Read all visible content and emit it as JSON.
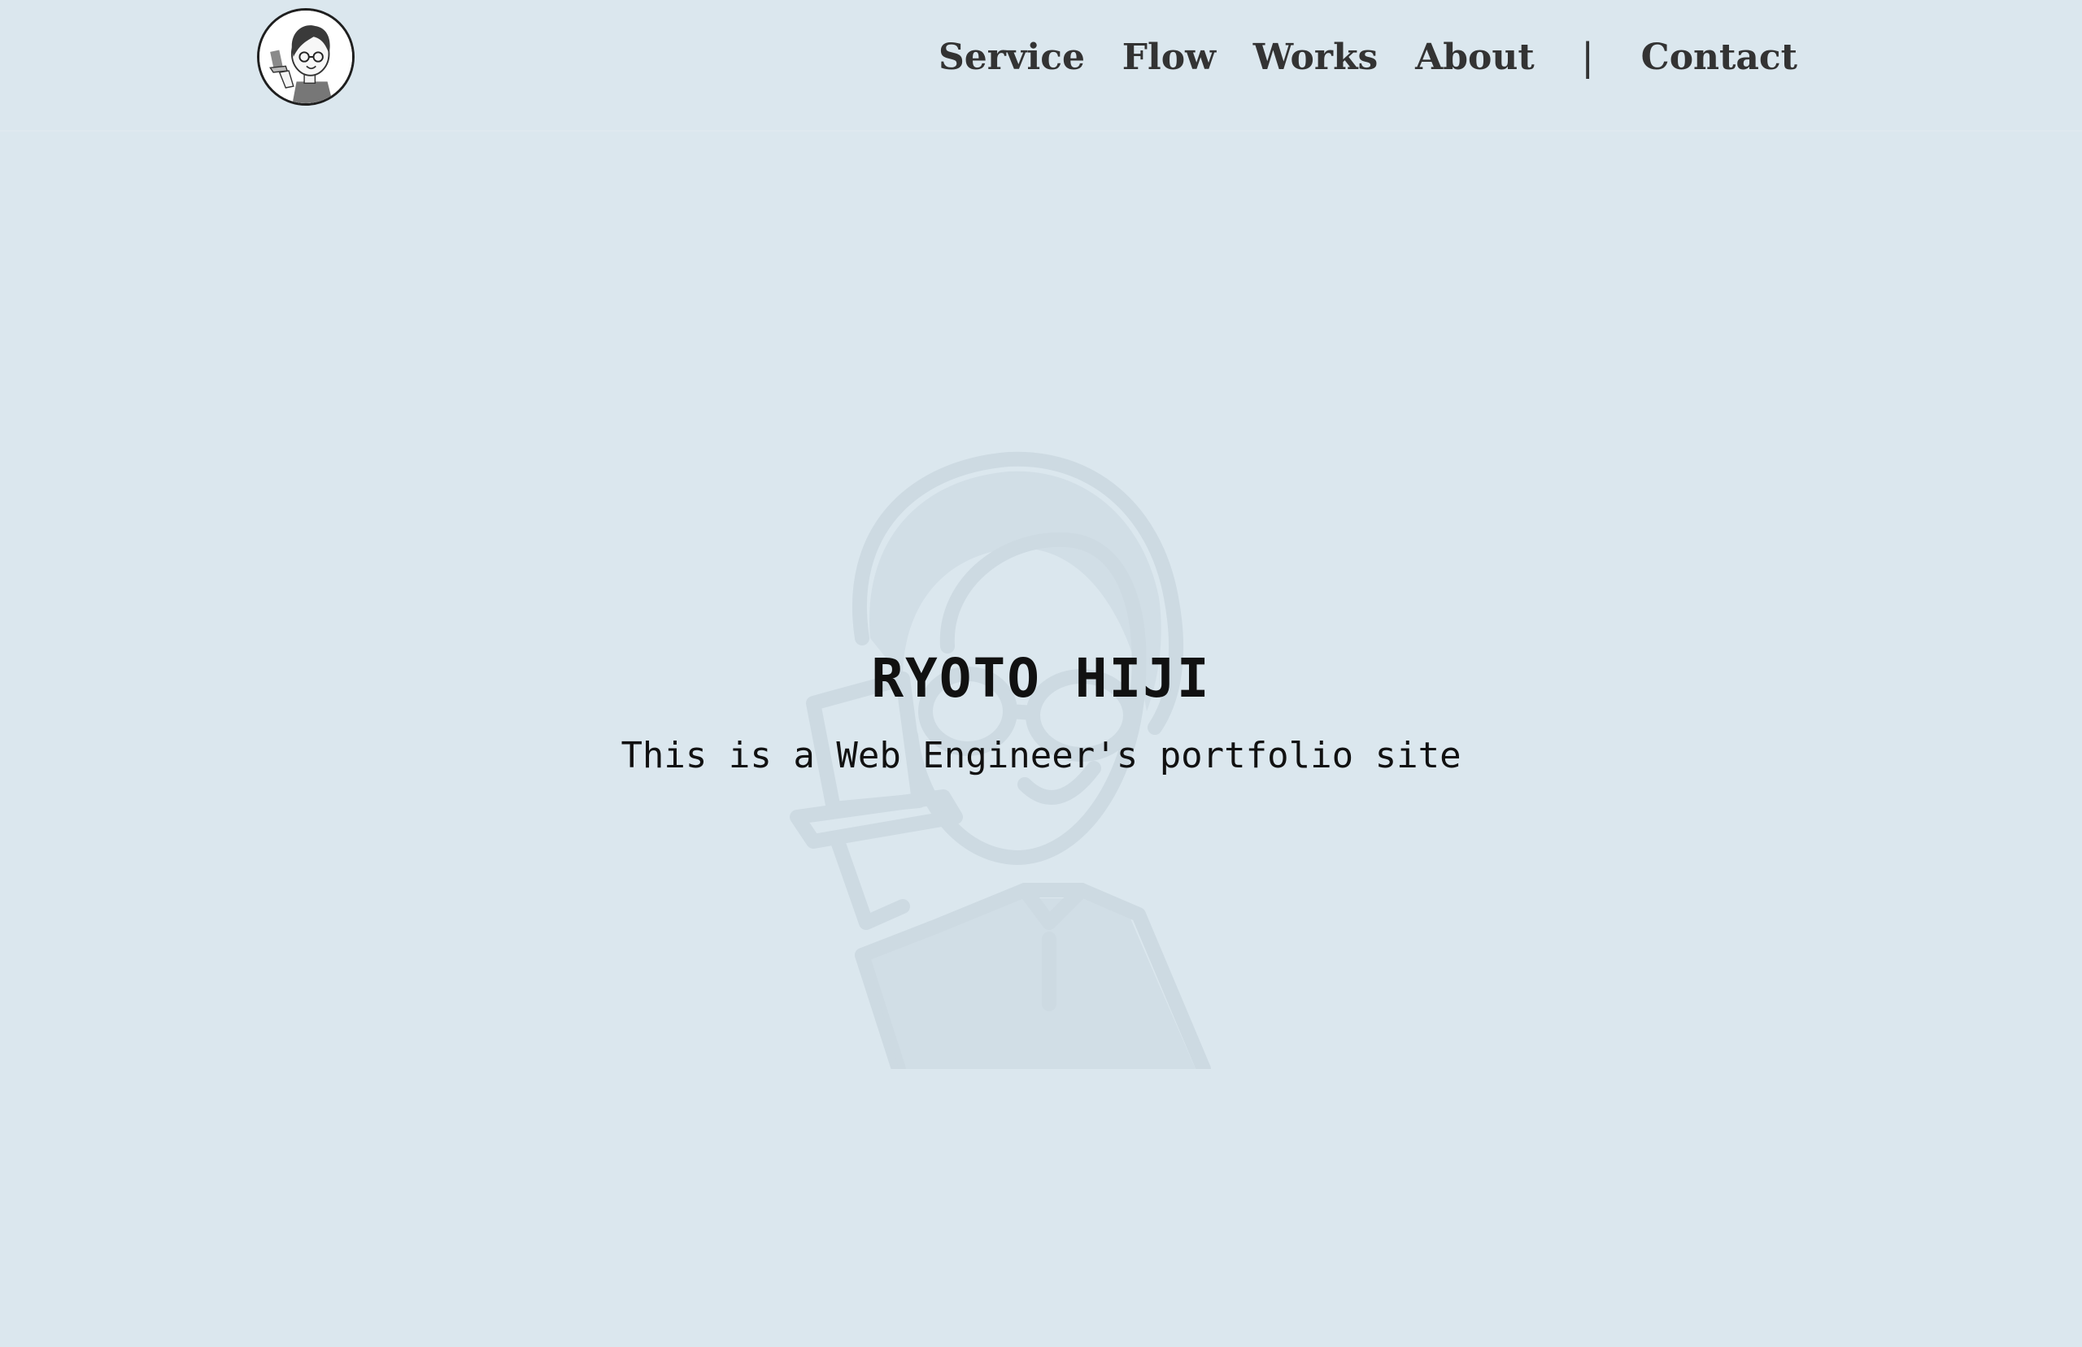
{
  "header": {
    "logo_icon": "avatar-illustration-icon",
    "nav": {
      "service": "Service",
      "flow": "Flow",
      "works": "Works",
      "about": "About",
      "separator": "|",
      "contact": "Contact"
    }
  },
  "hero": {
    "title": "RYOTO HIJI",
    "subtitle": "This is a Web Engineer's portfolio site",
    "background_art_icon": "character-illustration-icon"
  },
  "colors": {
    "background": "#dbe7ee",
    "text": "#111111",
    "nav_text": "#333333",
    "art_tint": "#c9d6de"
  }
}
